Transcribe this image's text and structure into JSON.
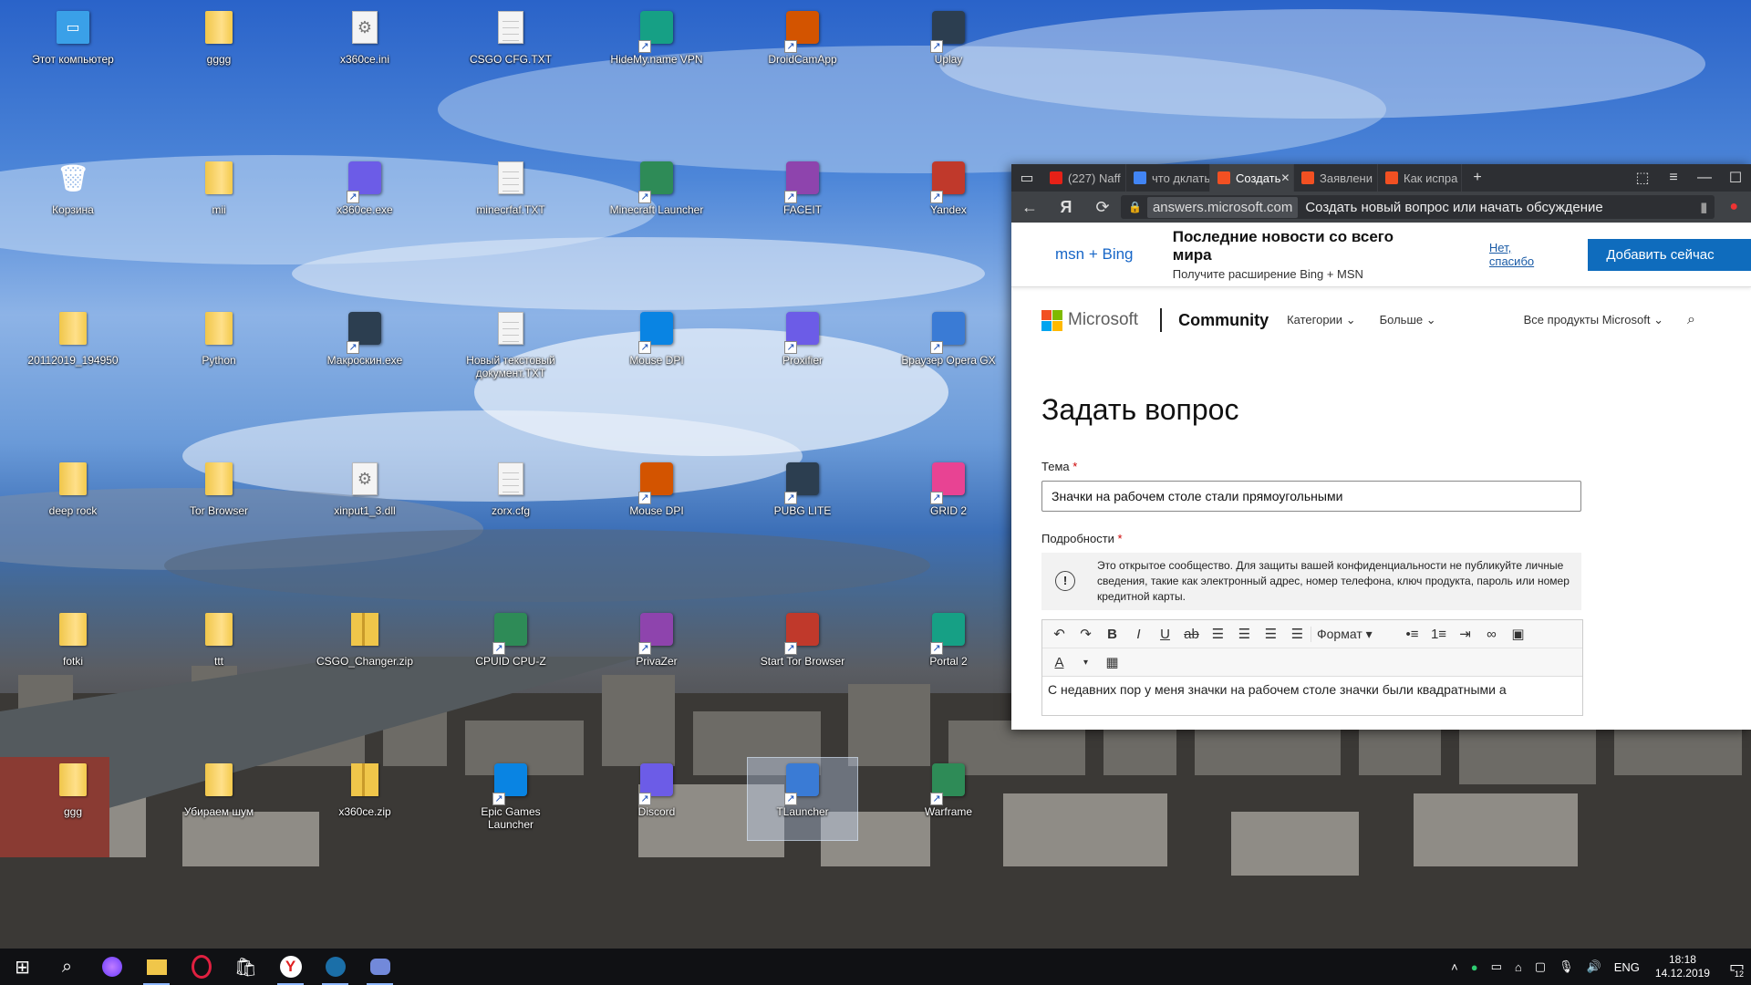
{
  "desktop": {
    "icons": [
      {
        "label": "Этот компьютер",
        "type": "pc"
      },
      {
        "label": "gggg",
        "type": "folder"
      },
      {
        "label": "x360ce.ini",
        "type": "settings"
      },
      {
        "label": "CSGO CFG.TXT",
        "type": "doc"
      },
      {
        "label": "HideMy.name VPN",
        "type": "app"
      },
      {
        "label": "DroidCamApp",
        "type": "app"
      },
      {
        "label": "Uplay",
        "type": "app"
      },
      {
        "label": "Корзина",
        "type": "bin"
      },
      {
        "label": "mii",
        "type": "folder"
      },
      {
        "label": "x360ce.exe",
        "type": "app"
      },
      {
        "label": "minecrfaf.TXT",
        "type": "doc"
      },
      {
        "label": "Minecraft Launcher",
        "type": "app"
      },
      {
        "label": "FACEIT",
        "type": "app"
      },
      {
        "label": "Yandex",
        "type": "app"
      },
      {
        "label": "20112019_194950",
        "type": "folder"
      },
      {
        "label": "Python",
        "type": "folder"
      },
      {
        "label": "Макроскин.exe",
        "type": "app"
      },
      {
        "label": "Новый текстовый документ.TXT",
        "type": "doc"
      },
      {
        "label": "Mouse DPI",
        "type": "app"
      },
      {
        "label": "Proxifier",
        "type": "app"
      },
      {
        "label": "Браузер Opera GX",
        "type": "app"
      },
      {
        "label": "deep rock",
        "type": "folder"
      },
      {
        "label": "Tor Browser",
        "type": "folder"
      },
      {
        "label": "xinput1_3.dll",
        "type": "settings"
      },
      {
        "label": "zorx.cfg",
        "type": "doc"
      },
      {
        "label": "Mouse DPI",
        "type": "app"
      },
      {
        "label": "PUBG LITE",
        "type": "app"
      },
      {
        "label": "GRID 2",
        "type": "app"
      },
      {
        "label": "fotki",
        "type": "folder"
      },
      {
        "label": "ttt",
        "type": "folder"
      },
      {
        "label": "CSGO_Changer.zip",
        "type": "zip"
      },
      {
        "label": "CPUID CPU-Z",
        "type": "app"
      },
      {
        "label": "PrivaZer",
        "type": "app"
      },
      {
        "label": "Start Tor Browser",
        "type": "app"
      },
      {
        "label": "Portal 2",
        "type": "app"
      },
      {
        "label": "ggg",
        "type": "folder"
      },
      {
        "label": "Убираем шум",
        "type": "folder"
      },
      {
        "label": "x360ce.zip",
        "type": "zip"
      },
      {
        "label": "Epic Games Launcher",
        "type": "app"
      },
      {
        "label": "Discord",
        "type": "app"
      },
      {
        "label": "TLauncher",
        "type": "app"
      },
      {
        "label": "Warframe",
        "type": "app"
      }
    ]
  },
  "browser": {
    "tabs": [
      {
        "label": "(227) Naff",
        "icon": "youtube-icon",
        "color": "#e62117"
      },
      {
        "label": "что дклать",
        "icon": "google-icon",
        "color": "#4285f4"
      },
      {
        "label": "Создать",
        "icon": "microsoft-icon",
        "color": "#f25022",
        "active": true
      },
      {
        "label": "Заявлени",
        "icon": "microsoft-icon",
        "color": "#f25022"
      },
      {
        "label": "Как испра",
        "icon": "microsoft-icon",
        "color": "#f25022"
      }
    ],
    "new_tab": "+",
    "address": {
      "domain": "answers.microsoft.com",
      "title": "Создать новый вопрос или начать обсуждение"
    },
    "banner": {
      "brand": "msn + Bing",
      "headline": "Последние новости со всего мира",
      "subline": "Получите расширение Bing + MSN",
      "no_thanks": "Нет, спасибо",
      "add_now": "Добавить сейчас"
    },
    "site": {
      "logo": "Microsoft",
      "section": "Community",
      "menu": [
        "Категории",
        "Больше"
      ],
      "all_products": "Все продукты Microsoft",
      "page_title": "Задать вопрос",
      "subject_label": "Тема",
      "subject_value": "Значки на рабочем столе стали прямоугольными",
      "details_label": "Подробности",
      "required_mark": "*",
      "notice": "Это открытое сообщество. Для защиты вашей конфиденциальности не публикуйте личные сведения, такие как электронный адрес, номер телефона, ключ продукта, пароль или номер кредитной карты.",
      "format_label": "Формат",
      "editor_text": "С недавних пор у меня значки на рабочем столе значки были квадратными а"
    }
  },
  "taskbar": {
    "language": "ENG",
    "time": "18:18",
    "date": "14.12.2019",
    "notifications": "12"
  }
}
